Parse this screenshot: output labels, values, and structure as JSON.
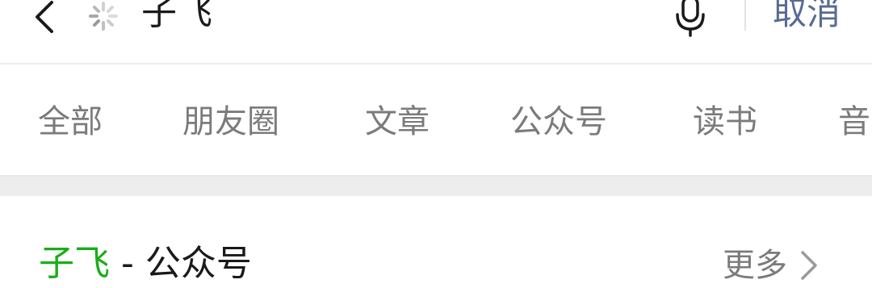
{
  "search": {
    "query": "子飞",
    "cancel_label": "取消"
  },
  "tabs": [
    {
      "label": "全部"
    },
    {
      "label": "朋友圈"
    },
    {
      "label": "文章"
    },
    {
      "label": "公众号"
    },
    {
      "label": "读书"
    },
    {
      "label": "音"
    }
  ],
  "section": {
    "keyword": "子飞",
    "suffix": " - 公众号",
    "more_label": "更多"
  },
  "colors": {
    "accent_green": "#1aad19",
    "link_blue": "#576b95",
    "muted_gray": "#7b7b7b"
  },
  "icons": {
    "back": "chevron-left-icon",
    "loading": "loading-spinner-icon",
    "mic": "microphone-icon",
    "more": "chevron-right-icon"
  }
}
